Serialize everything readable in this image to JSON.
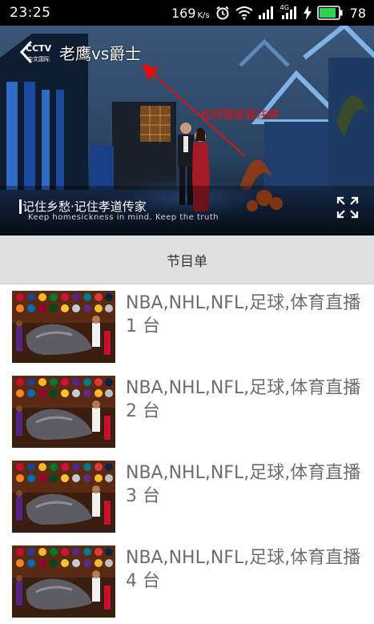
{
  "status_bar": {
    "time": "23:25",
    "net_speed": "169",
    "net_speed_unit": "K/s",
    "signal_label": "4G",
    "battery": "78",
    "icons": [
      "alarm-icon",
      "wifi-icon",
      "signal-icon",
      "signal-4g-icon",
      "charging-icon",
      "battery-icon"
    ]
  },
  "player": {
    "title": "老鹰vs爵士",
    "annotation": "视频播放器注解",
    "caption_cn": "记住乡愁·记住孝道传家",
    "caption_en": "Keep homesickness in mind. Keep the truth",
    "logo_text": "CCTV",
    "logo_subtext": "中文国际",
    "back_icon": "back-arrow-icon",
    "fullscreen_icon": "fullscreen-icon",
    "annotation_color": "#e01010"
  },
  "section": {
    "header": "节目单"
  },
  "channels": [
    {
      "title": "NBA,NHL,NFL,足球,体育直播1 台"
    },
    {
      "title": "NBA,NHL,NFL,足球,体育直播2 台"
    },
    {
      "title": "NBA,NHL,NFL,足球,体育直播3 台"
    },
    {
      "title": "NBA,NHL,NFL,足球,体育直播4 台"
    }
  ]
}
